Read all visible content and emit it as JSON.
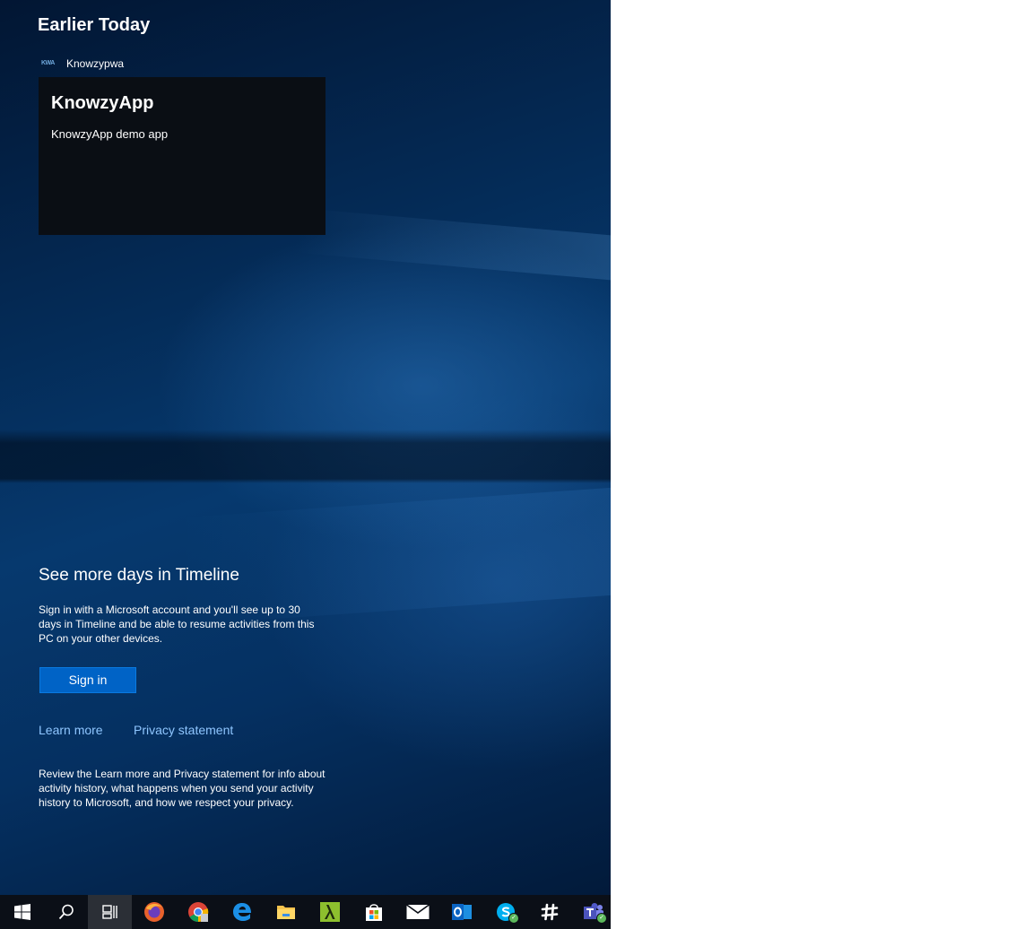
{
  "timeline": {
    "section_heading": "Earlier Today",
    "activity": {
      "app_icon_text": "KWA",
      "app_name": "Knowzypwa",
      "card_title": "KnowzyApp",
      "card_description": "KnowzyApp demo app"
    },
    "promo": {
      "heading": "See more days in Timeline",
      "body": "Sign in with a Microsoft account and you'll see up to 30 days in Timeline and be able to resume activities from this PC on your other devices.",
      "sign_in_label": "Sign in",
      "learn_more_label": "Learn more",
      "privacy_label": "Privacy statement",
      "privacy_note": "Review the Learn more and Privacy statement for info about activity history, what happens when you send your activity history to Microsoft, and how we respect your privacy."
    }
  },
  "taskbar": {
    "items": [
      {
        "name": "start-button",
        "icon": "windows-logo-icon"
      },
      {
        "name": "search-button",
        "icon": "search-icon"
      },
      {
        "name": "task-view-button",
        "icon": "task-view-icon",
        "active": true
      },
      {
        "name": "firefox",
        "icon": "firefox-icon"
      },
      {
        "name": "chrome",
        "icon": "chrome-icon"
      },
      {
        "name": "edge",
        "icon": "edge-icon"
      },
      {
        "name": "file-explorer",
        "icon": "folder-icon"
      },
      {
        "name": "lambda-app",
        "icon": "lambda-icon"
      },
      {
        "name": "store",
        "icon": "store-icon"
      },
      {
        "name": "mail",
        "icon": "mail-icon"
      },
      {
        "name": "outlook",
        "icon": "outlook-icon"
      },
      {
        "name": "skype",
        "icon": "skype-icon"
      },
      {
        "name": "slack",
        "icon": "slack-icon"
      },
      {
        "name": "teams",
        "icon": "teams-icon"
      }
    ],
    "colors": {
      "background": "#0b0f17",
      "accent": "#0063c6"
    }
  }
}
